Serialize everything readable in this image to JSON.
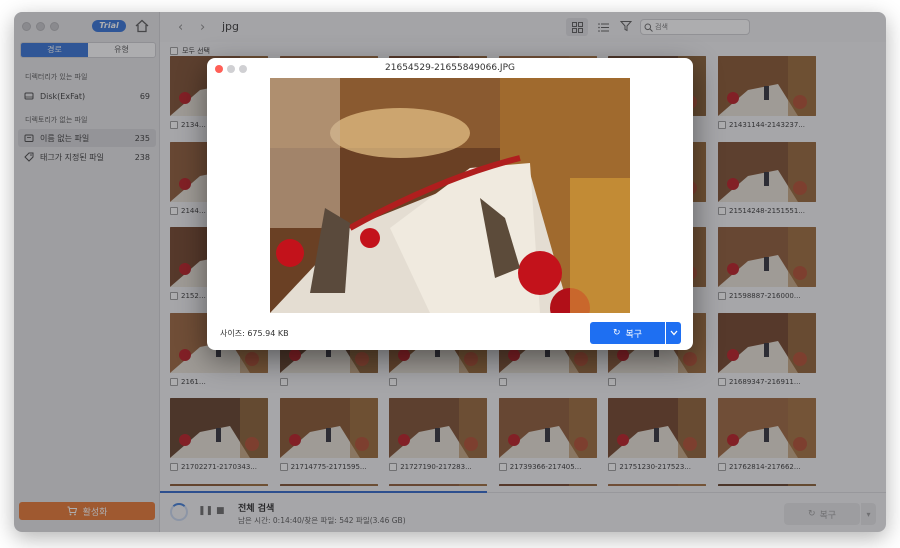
{
  "sidebar": {
    "trial_badge": "Trial",
    "tabs": [
      {
        "label": "경로",
        "active": true
      },
      {
        "label": "유형",
        "active": false
      }
    ],
    "section1_title": "디렉터리가 있는 파일",
    "section2_title": "디렉토리가 없는 파일",
    "items": [
      {
        "label": "Disk(ExFat)",
        "count": "69",
        "icon": "disk-icon"
      },
      {
        "label": "이름 없는 파일",
        "count": "235",
        "icon": "folder-icon"
      },
      {
        "label": "태그가 지정된 파일",
        "count": "238",
        "icon": "tag-icon"
      }
    ],
    "activate_label": "활성화"
  },
  "toolbar": {
    "path": "jpg",
    "search_placeholder": "검색"
  },
  "select_all_label": "모두 선택",
  "grid": {
    "rows": [
      [
        "2134…",
        "",
        "",
        "",
        "",
        "21431144-2143237..."
      ],
      [
        "2144…",
        "",
        "",
        "",
        "",
        "21514248-2151551..."
      ],
      [
        "2152…",
        "",
        "",
        "",
        "",
        "21598887-216000..."
      ],
      [
        "2161…",
        "",
        "",
        "",
        "",
        "21689347-216911..."
      ],
      [
        "21702271-2170343...",
        "21714775-2171595...",
        "21727190-217283...",
        "21739366-217405...",
        "21751230-217523...",
        "21762814-217662..."
      ],
      [
        "",
        "",
        "",
        "",
        "",
        ""
      ]
    ]
  },
  "status": {
    "title": "전체 검색",
    "subtitle": "남은 시간: 0:14:40/찾은 파일: 542 파일(3.46 GB)",
    "recover_label": "복구",
    "progress_percent": 45
  },
  "dialog": {
    "title": "21654529-21655849066.JPG",
    "size_label": "사이즈: 675.94 KB",
    "recover_label": "복구"
  },
  "colors": {
    "accent": "#1e6ff2",
    "activate": "#e8742c",
    "close_dot": "#ff5f57"
  }
}
